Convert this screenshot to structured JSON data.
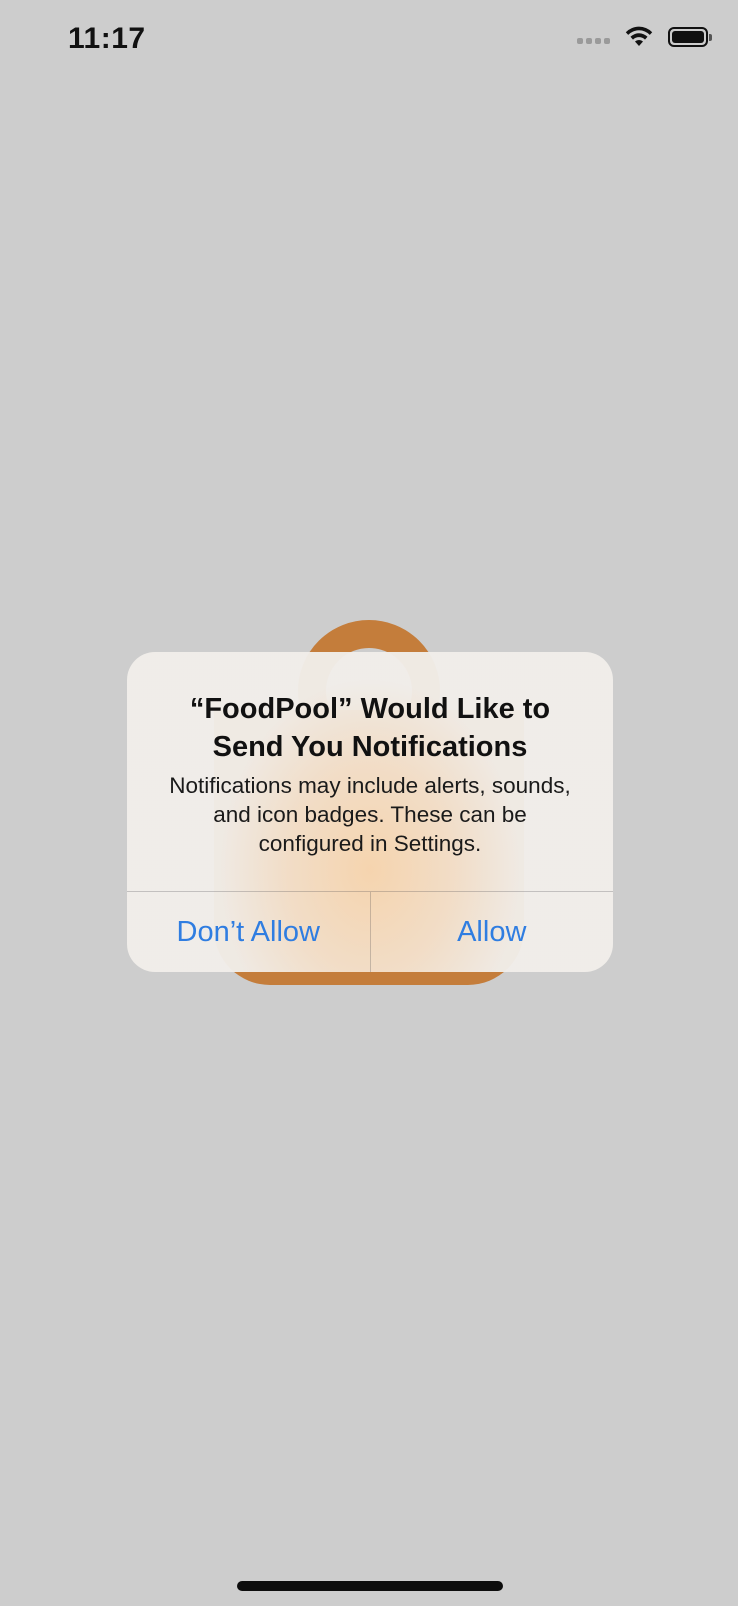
{
  "status_bar": {
    "time": "11:17",
    "signal_icon": "cellular-signal-icon",
    "wifi_icon": "wifi-icon",
    "battery_icon": "battery-icon"
  },
  "background_app": {
    "logo_icon": "shopping-bag-icon",
    "logo_color": "#c47d3b",
    "background_color": "#cdcdcd"
  },
  "alert": {
    "title": "“FoodPool” Would Like to Send You Notifications",
    "message": "Notifications may include alerts, sounds, and icon badges. These can be configured in Settings.",
    "dont_allow_label": "Don’t Allow",
    "allow_label": "Allow",
    "button_color": "#2f7de1"
  }
}
